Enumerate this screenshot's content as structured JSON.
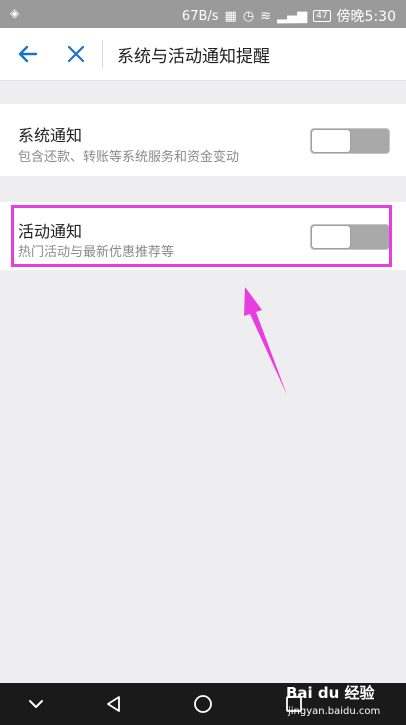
{
  "status_bar": {
    "network_speed": "67B/s",
    "battery": "47",
    "time_label": "傍晚5:30"
  },
  "header": {
    "title": "系统与活动通知提醒"
  },
  "settings": [
    {
      "title": "系统通知",
      "description": "包含还款、转账等系统服务和资金变动",
      "enabled": false
    },
    {
      "title": "活动通知",
      "description": "热门活动与最新优惠推荐等",
      "enabled": false
    }
  ],
  "annotation": {
    "highlight_color": "#e83de0"
  },
  "watermark": {
    "brand": "Bai du 经验",
    "url": "jingyan.baidu.com"
  },
  "colors": {
    "accent": "#1a73c8",
    "toggle_off": "#a9a9a9"
  }
}
